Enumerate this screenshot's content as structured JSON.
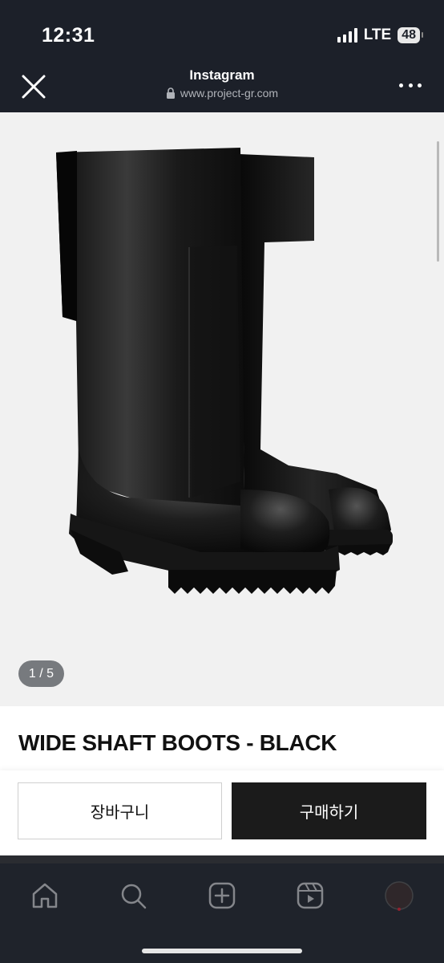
{
  "status_bar": {
    "time": "12:31",
    "network": "LTE",
    "battery": "48"
  },
  "browser": {
    "title": "Instagram",
    "url": "www.project-gr.com"
  },
  "gallery": {
    "counter": "1 / 5"
  },
  "product": {
    "title": "WIDE SHAFT BOOTS - BLACK"
  },
  "actions": {
    "cart_label": "장바구니",
    "buy_label": "구매하기"
  },
  "nav": {
    "items": [
      "home-icon",
      "search-icon",
      "create-icon",
      "reels-icon",
      "profile-avatar"
    ]
  },
  "colors": {
    "dark_bar": "#1c2029",
    "buy_button": "#1b1b1b",
    "gallery_bg": "#f1f1f1"
  }
}
